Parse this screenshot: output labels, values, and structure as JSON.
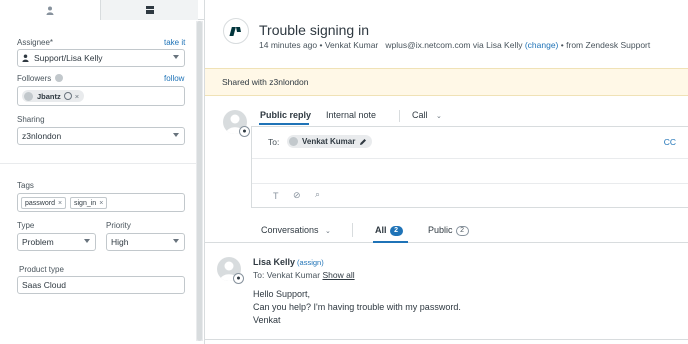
{
  "left": {
    "assignee": {
      "label": "Assignee*",
      "link": "take it",
      "value": "Support/Lisa Kelly"
    },
    "followers": {
      "label": "Followers",
      "link": "follow",
      "chip": "Jbantz"
    },
    "sharing": {
      "label": "Sharing",
      "value": "z3nlondon"
    },
    "tags": {
      "label": "Tags",
      "items": [
        "password",
        "sign_in"
      ]
    },
    "type": {
      "label": "Type",
      "value": "Problem"
    },
    "priority": {
      "label": "Priority",
      "value": "High"
    },
    "product_type": {
      "label": "Product type",
      "value": "Saas Cloud"
    }
  },
  "ticket": {
    "title": "Trouble signing in",
    "meta": {
      "time": "14 minutes ago",
      "bullet1": "•",
      "author": "Venkat Kumar",
      "email": "wplus@ix.netcom.com via Lisa Kelly",
      "change": "(change)",
      "bullet2": "•",
      "source": "from Zendesk Support"
    },
    "shared_with": "Shared with z3nlondon"
  },
  "composer": {
    "tabs": [
      "Public reply",
      "Internal note",
      "Call"
    ],
    "to_label": "To:",
    "to_chip": "Venkat Kumar",
    "cc": "CC",
    "tools": {
      "text": "T",
      "attach": "⊘",
      "search": "⌕"
    }
  },
  "conversations": {
    "label": "Conversations",
    "all_label": "All",
    "all_count": "2",
    "public_label": "Public",
    "public_count": "2"
  },
  "message": {
    "author": "Lisa Kelly",
    "assign": "(assign)",
    "to_prefix": "To: Venkat Kumar",
    "show_all": "Show all",
    "lines": [
      "Hello Support,",
      "Can you help? I'm having trouble with my password.",
      "Venkat"
    ]
  },
  "colors": {
    "accent": "#1f73b7",
    "shared_bg": "#fff8e7",
    "border": "#d8dcde"
  },
  "icons": [
    "user-icon",
    "apps-icon",
    "info-icon",
    "edit-icon",
    "zendesk-logo-icon",
    "chevron-down-icon"
  ]
}
